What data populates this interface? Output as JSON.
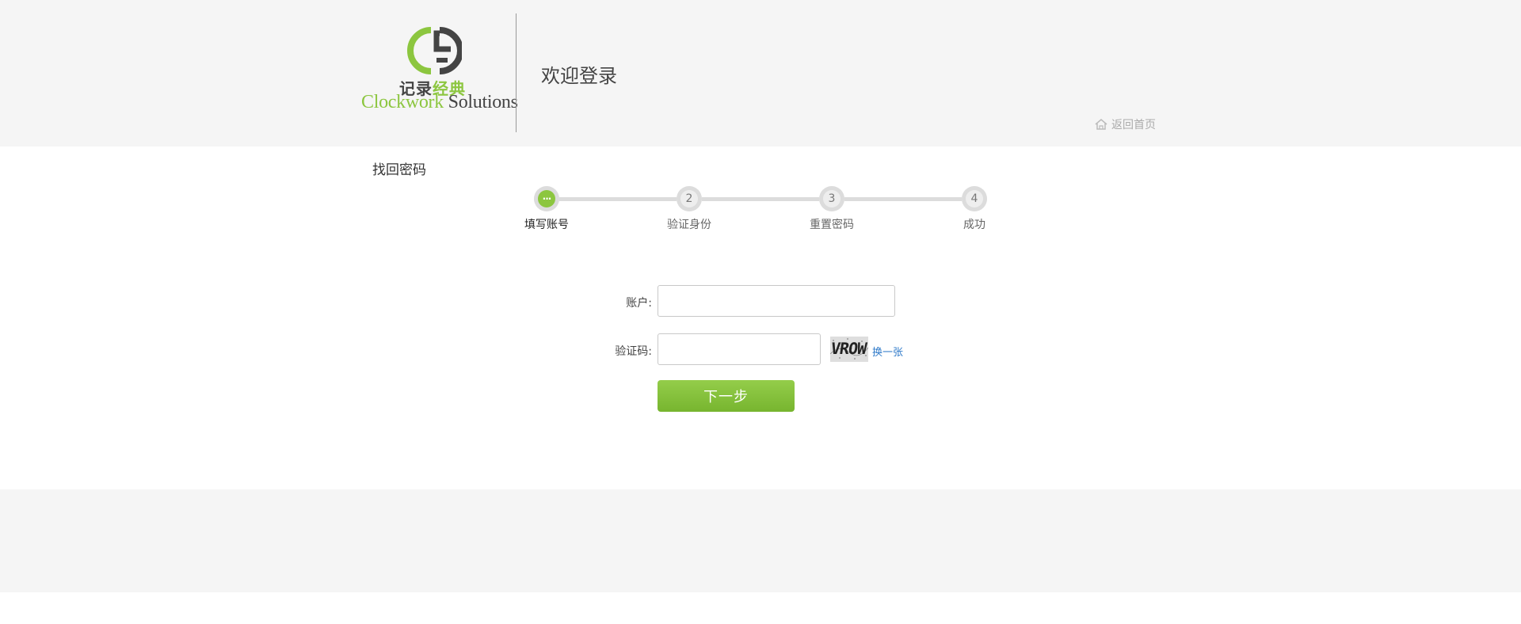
{
  "header": {
    "logo_cn_part1": "记录",
    "logo_cn_part2": "经典",
    "logo_en_part1": "Clockwork",
    "logo_en_part2": "Solutions",
    "welcome_text": "欢迎登录",
    "back_home_label": "返回首页"
  },
  "page": {
    "section_title": "找回密码"
  },
  "steps": [
    {
      "number": "···",
      "label": "填写账号",
      "active": true
    },
    {
      "number": "2",
      "label": "验证身份",
      "active": false
    },
    {
      "number": "3",
      "label": "重置密码",
      "active": false
    },
    {
      "number": "4",
      "label": "成功",
      "active": false
    }
  ],
  "form": {
    "account_label": "账户:",
    "account_value": "",
    "captcha_label": "验证码:",
    "captcha_value": "",
    "captcha_text": "VROW",
    "refresh_label": "换一张",
    "next_button": "下一步"
  },
  "colors": {
    "accent": "#8cc63f",
    "link": "#2f7ac9",
    "header_bg": "#f5f5f5"
  }
}
